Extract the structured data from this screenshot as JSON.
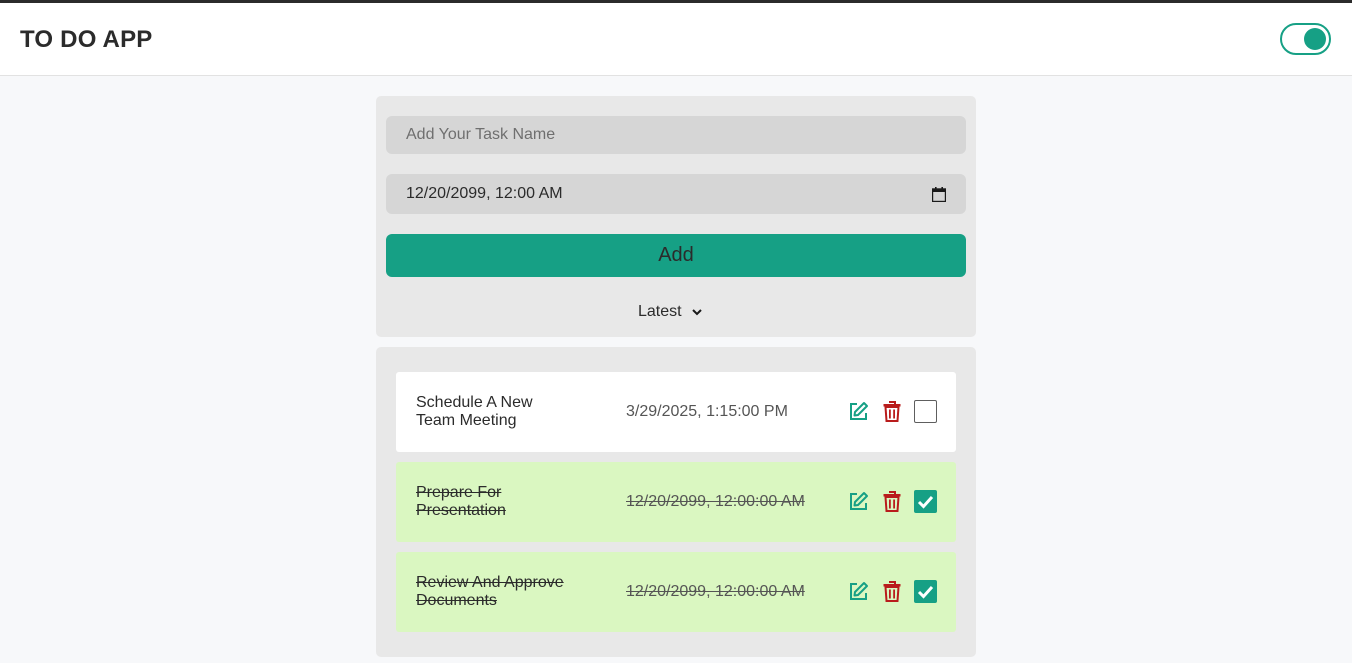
{
  "app": {
    "title": "TO DO APP"
  },
  "colors": {
    "accent": "#16a085",
    "danger": "#b91c1c",
    "done_bg": "#daf7c1",
    "card_bg": "#e8e8e8",
    "input_bg": "#d6d6d6"
  },
  "theme_toggle": {
    "state": "on",
    "icon": "toggle-icon"
  },
  "form": {
    "task_placeholder": "Add Your Task Name",
    "task_value": "",
    "date_value": "12/20/2099, 12:00 AM",
    "add_label": "Add",
    "sort_selected": "Latest"
  },
  "tasks": [
    {
      "name": "Schedule A New Team Meeting",
      "date": "3/29/2025, 1:15:00 PM",
      "completed": false
    },
    {
      "name": "Prepare For Presentation",
      "date": "12/20/2099, 12:00:00 AM",
      "completed": true
    },
    {
      "name": "Review And Approve Documents",
      "date": "12/20/2099, 12:00:00 AM",
      "completed": true
    }
  ]
}
